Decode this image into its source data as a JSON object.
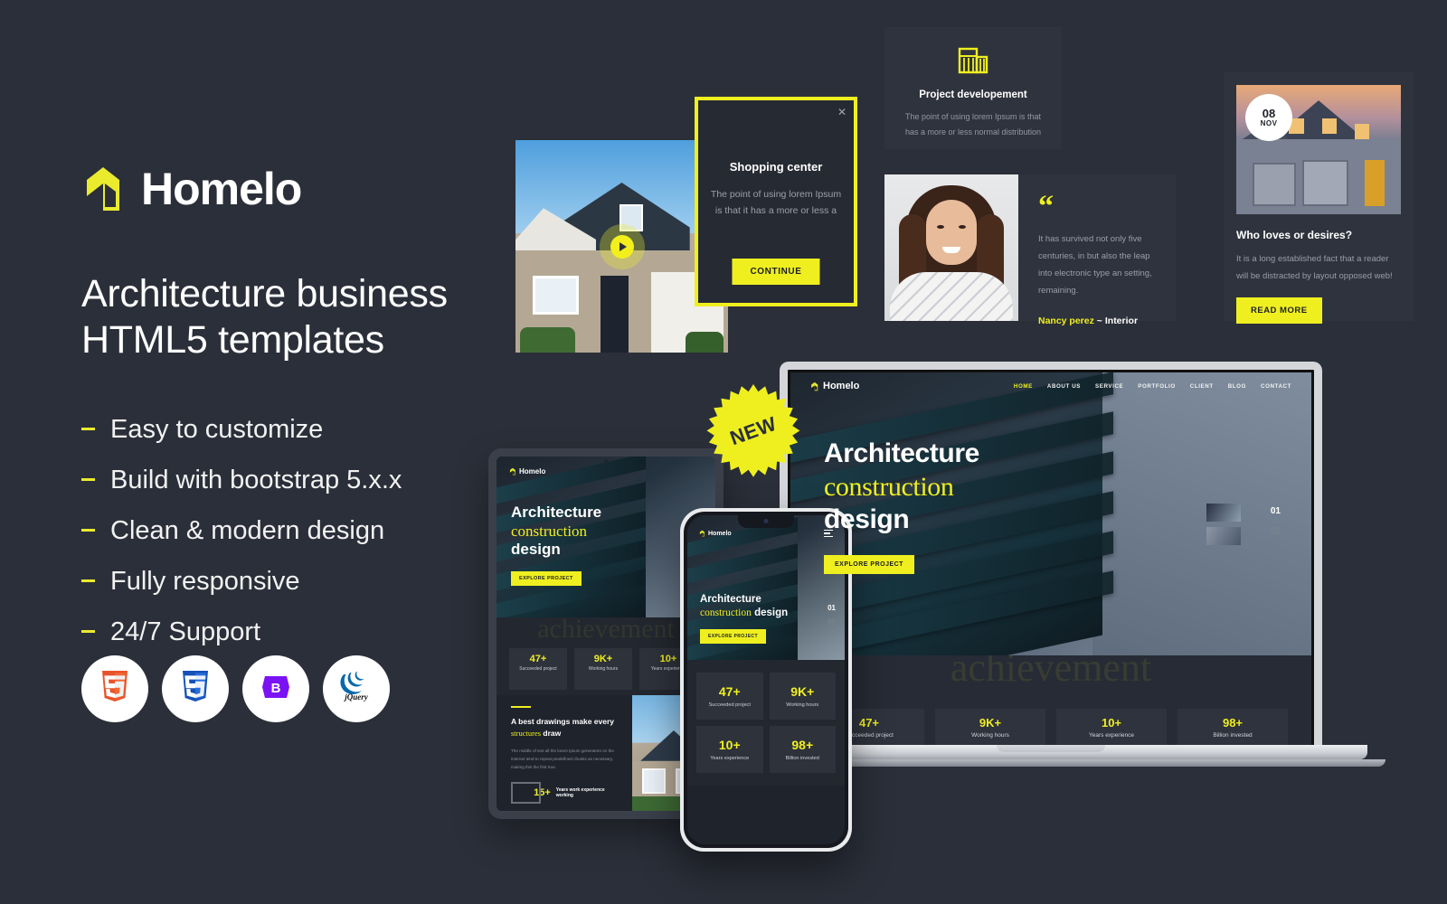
{
  "brand": {
    "name": "Homelo",
    "logo_icon": "homelo-logo-icon",
    "accent": "#eaeb2d"
  },
  "hero": {
    "headline_line1": "Architecture business",
    "headline_line2": "HTML5 templates"
  },
  "features": [
    {
      "label": "Easy to customize"
    },
    {
      "label": "Build with bootstrap 5.x.x"
    },
    {
      "label": "Clean & modern design"
    },
    {
      "label": "Fully responsive"
    },
    {
      "label": "24/7 Support"
    }
  ],
  "tech_badges": [
    {
      "name": "html5-icon",
      "label": "5",
      "color": "#e8542a"
    },
    {
      "name": "css3-icon",
      "label": "3",
      "color": "#1e6ed6"
    },
    {
      "name": "bootstrap-icon",
      "label": "B",
      "color": "#7a12f4"
    },
    {
      "name": "jquery-icon",
      "label": "jQuery",
      "color": "#0769ad"
    }
  ],
  "video_card": {
    "icon": "play-icon"
  },
  "modal": {
    "close_icon": "close-icon",
    "title": "Shopping center",
    "text": "The point of using lorem Ipsum is that it has a more or less a",
    "button": "CONTINUE",
    "border_color": "#efef20"
  },
  "service_card": {
    "icon": "building-icon",
    "title": "Project developement",
    "text": "The point of using lorem Ipsum is that has a more or less normal distribution"
  },
  "testimonial": {
    "quote_icon": "quote-icon",
    "text": "It has survived not only five centuries, in but also the leap into electronic type an setting, remaining.",
    "author_name": "Nancy perez",
    "author_sep": "~",
    "author_role": "Interior",
    "avatar": "woman-portrait"
  },
  "blog_card": {
    "date_day": "08",
    "date_month": "NOV",
    "title": "Who loves or desires?",
    "text": "It is a long established fact that a reader will be distracted by layout opposed web!",
    "button": "READ MORE"
  },
  "new_badge": {
    "label": "NEW",
    "color": "#efef20"
  },
  "laptop": {
    "nav": {
      "logo": "Homelo",
      "items": [
        {
          "label": "HOME",
          "active": true
        },
        {
          "label": "ABOUT US",
          "active": false
        },
        {
          "label": "SERVICE",
          "active": false
        },
        {
          "label": "PORTFOLIO",
          "active": false
        },
        {
          "label": "CLIENT",
          "active": false
        },
        {
          "label": "BLOG",
          "active": false
        },
        {
          "label": "CONTACT",
          "active": false
        }
      ]
    },
    "hero": {
      "line1": "Architecture",
      "line2": "construction",
      "line3": "design",
      "button": "EXPLORE PROJECT",
      "slide_current": "01",
      "slide_next": "02"
    },
    "achievement": {
      "watermark": "achievement",
      "stats": [
        {
          "num": "47+",
          "label": "Succeeded project"
        },
        {
          "num": "9K+",
          "label": "Working hours"
        },
        {
          "num": "10+",
          "label": "Years experience"
        },
        {
          "num": "98+",
          "label": "Billion invested"
        }
      ]
    }
  },
  "tablet": {
    "logo": "Homelo",
    "hero": {
      "line1": "Architecture",
      "line2": "construction",
      "line3": "design",
      "button": "EXPLORE PROJECT"
    },
    "achievement": {
      "watermark": "achievement",
      "stats": [
        {
          "num": "47+",
          "label": "Succeeded project"
        },
        {
          "num": "9K+",
          "label": "Working hours"
        },
        {
          "num": "10+",
          "label": "Years experience"
        }
      ]
    },
    "about": {
      "title_a": "A best drawings make every",
      "title_b": "structures",
      "title_c": "draw",
      "text": "The middle of text all the lorem Ipsum generators on the internet tend to repeat predefined chunks as necessary, making this the first true.",
      "exp_num": "15+",
      "exp_label": "Years work experience working"
    }
  },
  "phone": {
    "logo": "Homelo",
    "menu_icon": "hamburger-icon",
    "hero": {
      "line1": "Architecture",
      "line2": "construction",
      "line3": "design",
      "button": "EXPLORE PROJECT",
      "slide_current": "01",
      "slide_next": "02"
    },
    "stats": [
      {
        "num": "47+",
        "label": "Succeeded project"
      },
      {
        "num": "9K+",
        "label": "Working hours"
      },
      {
        "num": "10+",
        "label": "Years experience"
      },
      {
        "num": "98+",
        "label": "Billion invested"
      }
    ]
  }
}
